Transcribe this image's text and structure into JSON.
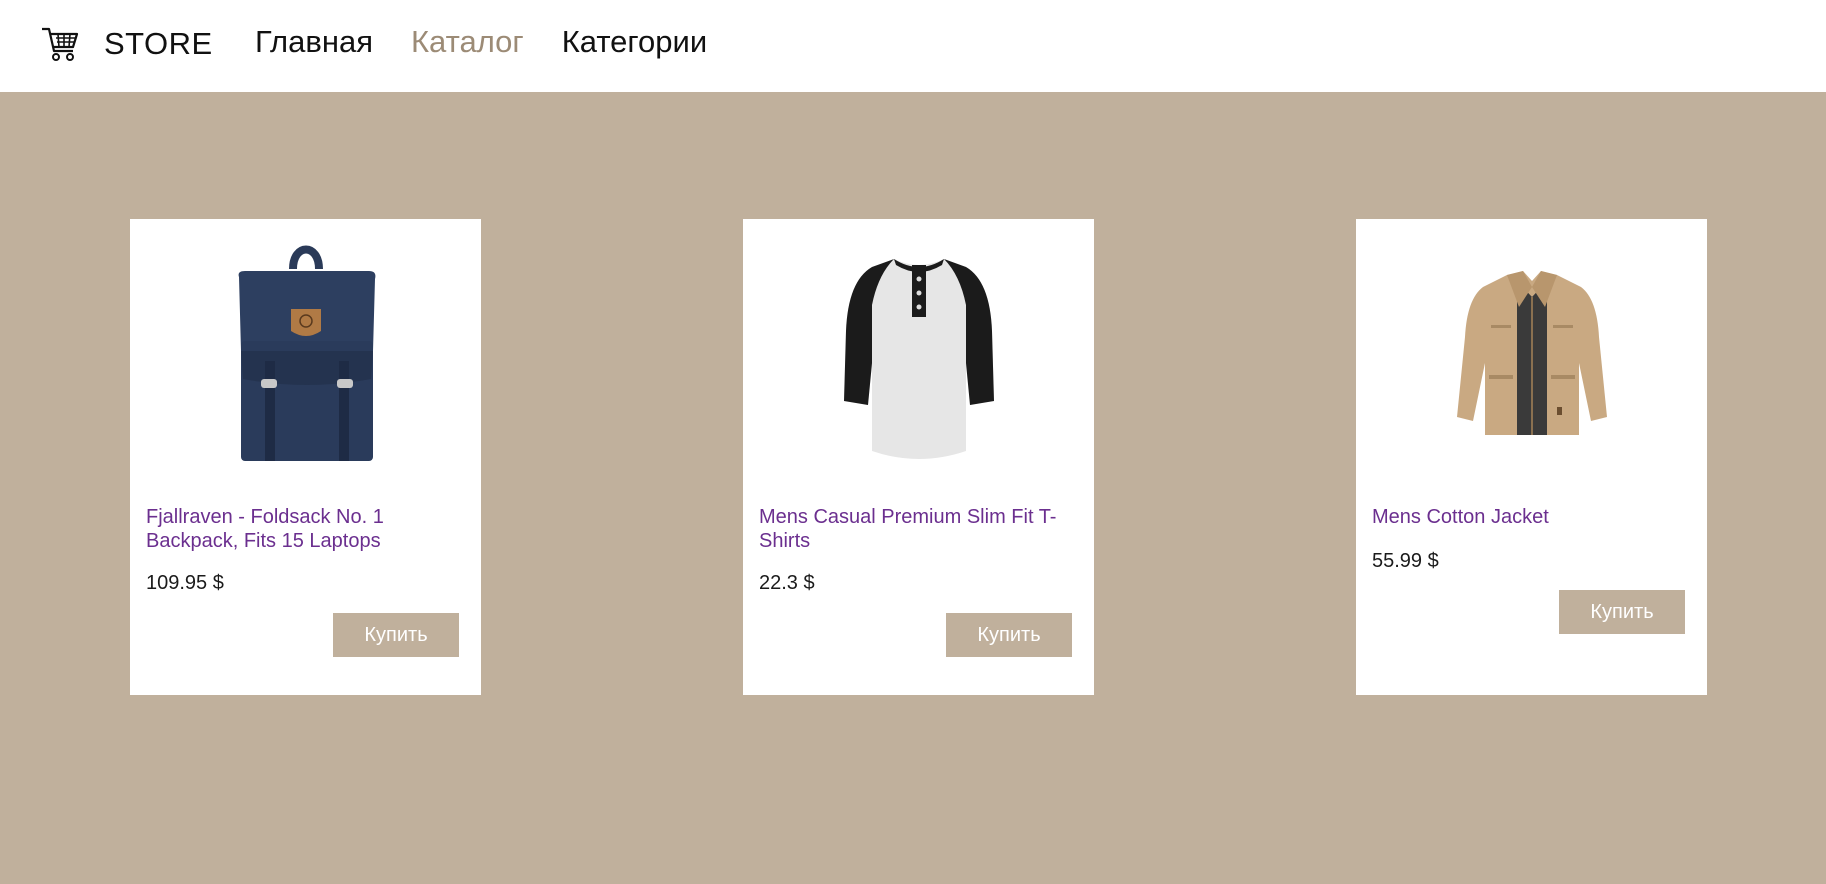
{
  "header": {
    "logo_icon": "shopping-cart-icon",
    "brand": "STORE",
    "nav": [
      {
        "label": "Главная",
        "active": false
      },
      {
        "label": "Каталог",
        "active": true
      },
      {
        "label": "Категории",
        "active": false
      }
    ]
  },
  "products": [
    {
      "image": "backpack",
      "title": "Fjallraven - Foldsack No. 1 Backpack, Fits 15 Laptops",
      "price": "109.95 $",
      "buy_label": "Купить"
    },
    {
      "image": "raglan-t-shirt",
      "title": "Mens Casual Premium Slim Fit T-Shirts",
      "price": "22.3 $",
      "buy_label": "Купить"
    },
    {
      "image": "cotton-jacket",
      "title": "Mens Cotton Jacket",
      "price": "55.99 $",
      "buy_label": "Купить"
    }
  ],
  "colors": {
    "background": "#c0b09c",
    "header": "#ffffff",
    "accent_nav": "#9c8b76",
    "product_title": "#6b2f8f",
    "button": "#c0b09c",
    "button_text": "#ffffff"
  }
}
